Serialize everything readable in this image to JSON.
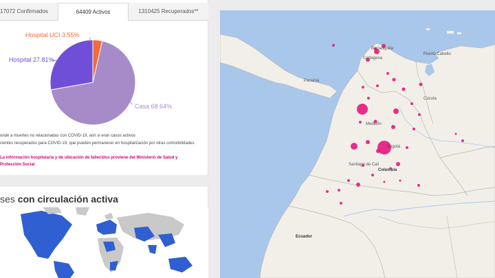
{
  "tabs": [
    {
      "label": "17072 Confirmados"
    },
    {
      "label": "64409 Activos"
    },
    {
      "label": "1310425 Recuperados**"
    }
  ],
  "pie": {
    "slices": [
      {
        "name": "Casa 68.64%",
        "value": 68.64,
        "color": "#a78bc9"
      },
      {
        "name": "Hospital 27.81%",
        "value": 27.81,
        "color": "#6f4fd8"
      },
      {
        "name": "Hospital UCI 3.55%",
        "value": 3.55,
        "color": "#f26b3a"
      }
    ]
  },
  "footnotes": {
    "line1": "onde a muertes no relacionadas con COVID-19, aún si eran casos activos",
    "line2": "cientes recuperados para COVID-19, que pueden permanecer en hospitalización por otras comorbilidades",
    "source1": "La información hospitalaria y de ubicación de fallecidos proviene del Ministerio de Salud y",
    "source2": "Protección Social"
  },
  "circulation": {
    "prefix": "ses ",
    "bold": "con circulación activa"
  },
  "map": {
    "colors": {
      "water": "#a9c7ea",
      "land": "#f2efe9",
      "bubble": "#e5177f",
      "border": "#b9b4ad"
    },
    "cities": [
      "Barranquilla",
      "Cartagena",
      "Cúcuta",
      "Medellín",
      "Bogotá",
      "Santiago de Cali",
      "Colombia",
      "Panamá",
      "Ecuador",
      "Puerto Cabello"
    ]
  }
}
